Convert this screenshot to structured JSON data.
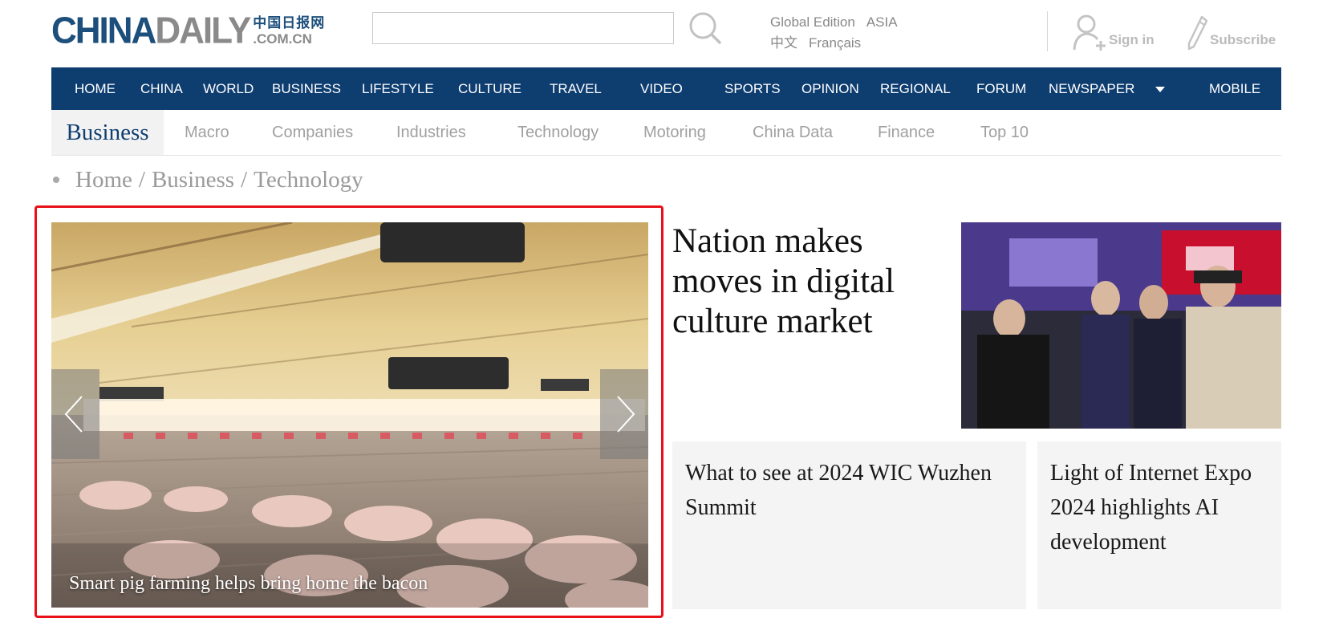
{
  "header": {
    "logo": {
      "china": "CHINA",
      "daily": "DAILY",
      "cn_name": "中国日报网",
      "domain": ".COM.CN"
    },
    "search": {
      "value": "",
      "placeholder": "",
      "icon": "search-icon"
    },
    "editions": {
      "global": "Global Edition",
      "asia": "ASIA",
      "chinese": "中文",
      "french": "Français"
    },
    "user": {
      "sign_in": "Sign in",
      "subscribe": "Subscribe"
    }
  },
  "main_nav": {
    "items": [
      "HOME",
      "CHINA",
      "WORLD",
      "BUSINESS",
      "LIFESTYLE",
      "CULTURE",
      "TRAVEL",
      "VIDEO",
      "SPORTS",
      "OPINION",
      "REGIONAL",
      "FORUM",
      "NEWSPAPER",
      "MOBILE"
    ],
    "background": "#0e3d70"
  },
  "sub_nav": {
    "section": "Business",
    "items": [
      "Macro",
      "Companies",
      "Industries",
      "Technology",
      "Motoring",
      "China Data",
      "Finance",
      "Top 10"
    ]
  },
  "breadcrumb": {
    "items": [
      "Home",
      "Business",
      "Technology"
    ],
    "separator": "/"
  },
  "carousel": {
    "caption": "Smart pig farming helps bring home the bacon",
    "highlight_color": "#e8111a"
  },
  "headline": {
    "title": "Nation makes moves in digital culture market"
  },
  "cards": [
    {
      "title": "What to see at 2024 WIC Wuzhen Summit"
    },
    {
      "title": "Light of Internet Expo 2024 highlights AI development"
    }
  ]
}
